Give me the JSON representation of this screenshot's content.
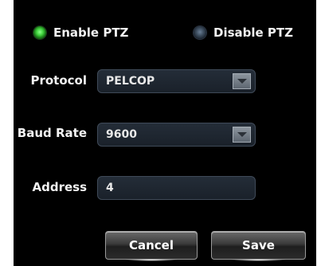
{
  "ptz": {
    "enable_label": "Enable PTZ",
    "disable_label": "Disable PTZ",
    "enabled": true
  },
  "protocol": {
    "label": "Protocol",
    "value": "PELCOP"
  },
  "baud_rate": {
    "label": "Baud Rate",
    "value": "9600"
  },
  "address": {
    "label": "Address",
    "value": "4"
  },
  "buttons": {
    "cancel_label": "Cancel",
    "save_label": "Save"
  },
  "colors": {
    "background": "#000000",
    "radio_on": "#3fd13c",
    "radio_off": "#3b4b5c",
    "field_bg": "#1f2730"
  }
}
